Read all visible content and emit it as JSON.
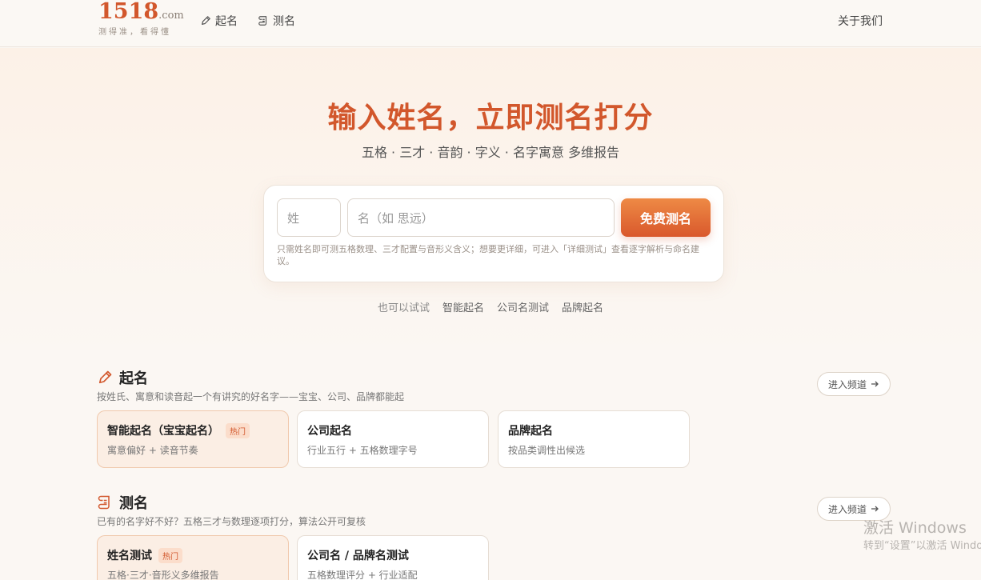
{
  "header": {
    "logo_main": "1518",
    "logo_domain": ".com",
    "logo_slogan": "测得准，看得懂",
    "nav": [
      {
        "label": "起名",
        "icon": "pencil-icon"
      },
      {
        "label": "测名",
        "icon": "scroll-icon"
      }
    ],
    "about": "关于我们"
  },
  "hero": {
    "title": "输入姓名，立即测名打分",
    "subtitle": "五格 · 三才 · 音韵 · 字义 · 名字寓意 多维报告",
    "surname_placeholder": "姓",
    "given_placeholder": "名（如 思远）",
    "submit_label": "免费测名",
    "hint": "只需姓名即可测五格数理、三才配置与音形义含义；想要更详细，可进入「详细测试」查看逐字解析与命名建议。",
    "alt_prefix": "也可以试试",
    "alt_links": [
      "智能起名",
      "公司名测试",
      "品牌起名"
    ]
  },
  "sections": [
    {
      "title": "起名",
      "icon": "pencil-icon",
      "desc": "按姓氏、寓意和读音起一个有讲究的好名字——宝宝、公司、品牌都能起",
      "enter_label": "进入频道",
      "cards": [
        {
          "title": "智能起名（宝宝起名）",
          "badge": "热门",
          "desc": "寓意偏好 + 读音节奏",
          "hot": true
        },
        {
          "title": "公司起名",
          "badge": "",
          "desc": "行业五行 + 五格数理字号",
          "hot": false
        },
        {
          "title": "品牌起名",
          "badge": "",
          "desc": "按品类调性出候选",
          "hot": false
        }
      ]
    },
    {
      "title": "测名",
      "icon": "scroll-icon",
      "desc": "已有的名字好不好？五格三才与数理逐项打分，算法公开可复核",
      "enter_label": "进入频道",
      "cards": [
        {
          "title": "姓名测试",
          "badge": "热门",
          "desc": "五格·三才·音形义多维报告",
          "hot": true
        },
        {
          "title": "公司名 / 品牌名测试",
          "badge": "",
          "desc": "五格数理评分 + 行业适配",
          "hot": false
        }
      ]
    }
  ],
  "watermark": {
    "line1": "激活 Windows",
    "line2": "转到“设置”以激活 Windows。"
  },
  "colors": {
    "accent": "#d2572c",
    "accent_light": "#ee8a45",
    "hot_card_bg": "#fbeee4"
  }
}
